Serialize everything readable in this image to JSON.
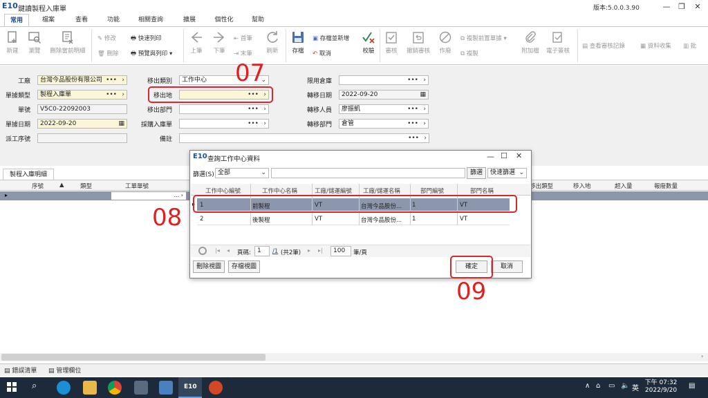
{
  "window": {
    "logo": "E10",
    "title": "鍵讀製程入庫單",
    "version": "版本:5.0.0.3.90"
  },
  "menu_tabs": [
    "常用",
    "檔案",
    "查看",
    "功能",
    "相關查詢",
    "擴展",
    "個性化",
    "幫助"
  ],
  "ribbon": {
    "new": "新建",
    "browse": "瀏覽",
    "delete_detail": "刪除當前明細",
    "modify": "修改",
    "delete": "刪除",
    "quick_print": "快速列印",
    "preview_print": "預覽與列印",
    "prev": "上筆",
    "next": "下筆",
    "first": "首筆",
    "last": "末筆",
    "refresh": "刷新",
    "save": "存檔",
    "save_new": "存檔並新增",
    "cancel": "取消",
    "verify": "校驗",
    "audit": "審核",
    "unaudit": "撤銷審核",
    "void": "作廢",
    "copy_prev": "複製前置單據",
    "copy": "複製",
    "attachment": "附加檔",
    "esign": "電子簽核",
    "view_audit": "查看審核記錄",
    "collect": "資料收集",
    "batch": "批"
  },
  "form": {
    "factory_label": "工廠",
    "factory_value": "台灣今品股份有限公司",
    "doc_type_label": "單據類型",
    "doc_type_value": "製程入庫單",
    "doc_no_label": "單號",
    "doc_no_value": "V5C0-22092003",
    "doc_date_label": "單據日期",
    "doc_date_value": "2022-09-20",
    "source_label": "派工序號",
    "out_type_label": "移出類別",
    "out_type_value": "工作中心",
    "out_place_label": "移出地",
    "out_dept_label": "移出部門",
    "purchase_label": "採購入庫單",
    "remark_label": "備註",
    "limit_wh_label": "限用倉庫",
    "transfer_date_label": "轉移日期",
    "transfer_date_value": "2022-09-20",
    "transfer_person_label": "轉移人員",
    "transfer_person_value": "廖振凱",
    "transfer_dept_label": "轉移部門",
    "transfer_dept_value": "倉管"
  },
  "detail": {
    "tab": "製程入庫明細",
    "columns": [
      "序號",
      "類型",
      "工單單號",
      "移出類型",
      "移入地",
      "超入量",
      "報廢數量"
    ],
    "first_row_dots": "..."
  },
  "bottom_tabs": [
    "錯誤清單",
    "管理欄位"
  ],
  "dialog": {
    "logo": "E10",
    "title": "查詢工作中心資料",
    "filter_label": "篩選(S)",
    "filter_value": "全部",
    "filter_button": "篩選",
    "quick_filter": "快速篩選",
    "columns": [
      "工作中心編號",
      "工作中心名稱",
      "工廠/儲運編號",
      "工廠/儲運名稱",
      "部門編號",
      "部門名稱"
    ],
    "rows": [
      [
        "1",
        "前製程",
        "VT",
        "台灣今品股份...",
        "1",
        "VT"
      ],
      [
        "2",
        "後製程",
        "VT",
        "台灣今品股份...",
        "1",
        "VT"
      ]
    ],
    "pager_label": "頁碼:",
    "page_value": "1",
    "page_total": "/1",
    "page_count": "(共2筆)",
    "per_page_value": "100",
    "per_page_label": "筆/頁",
    "delete_view": "刪除視圖",
    "save_view": "存檔視圖",
    "ok": "確定",
    "cancel": "取消"
  },
  "annotations": [
    "07",
    "08",
    "09"
  ],
  "taskbar": {
    "time": "下午 07:32",
    "date": "2022/9/20",
    "ime": "英"
  },
  "colors": {
    "annotation_red": "#d9262b",
    "selected_row": "#8c97ad",
    "input_yellow": "#fbf6d6",
    "taskbar": "#1c2a3a"
  }
}
